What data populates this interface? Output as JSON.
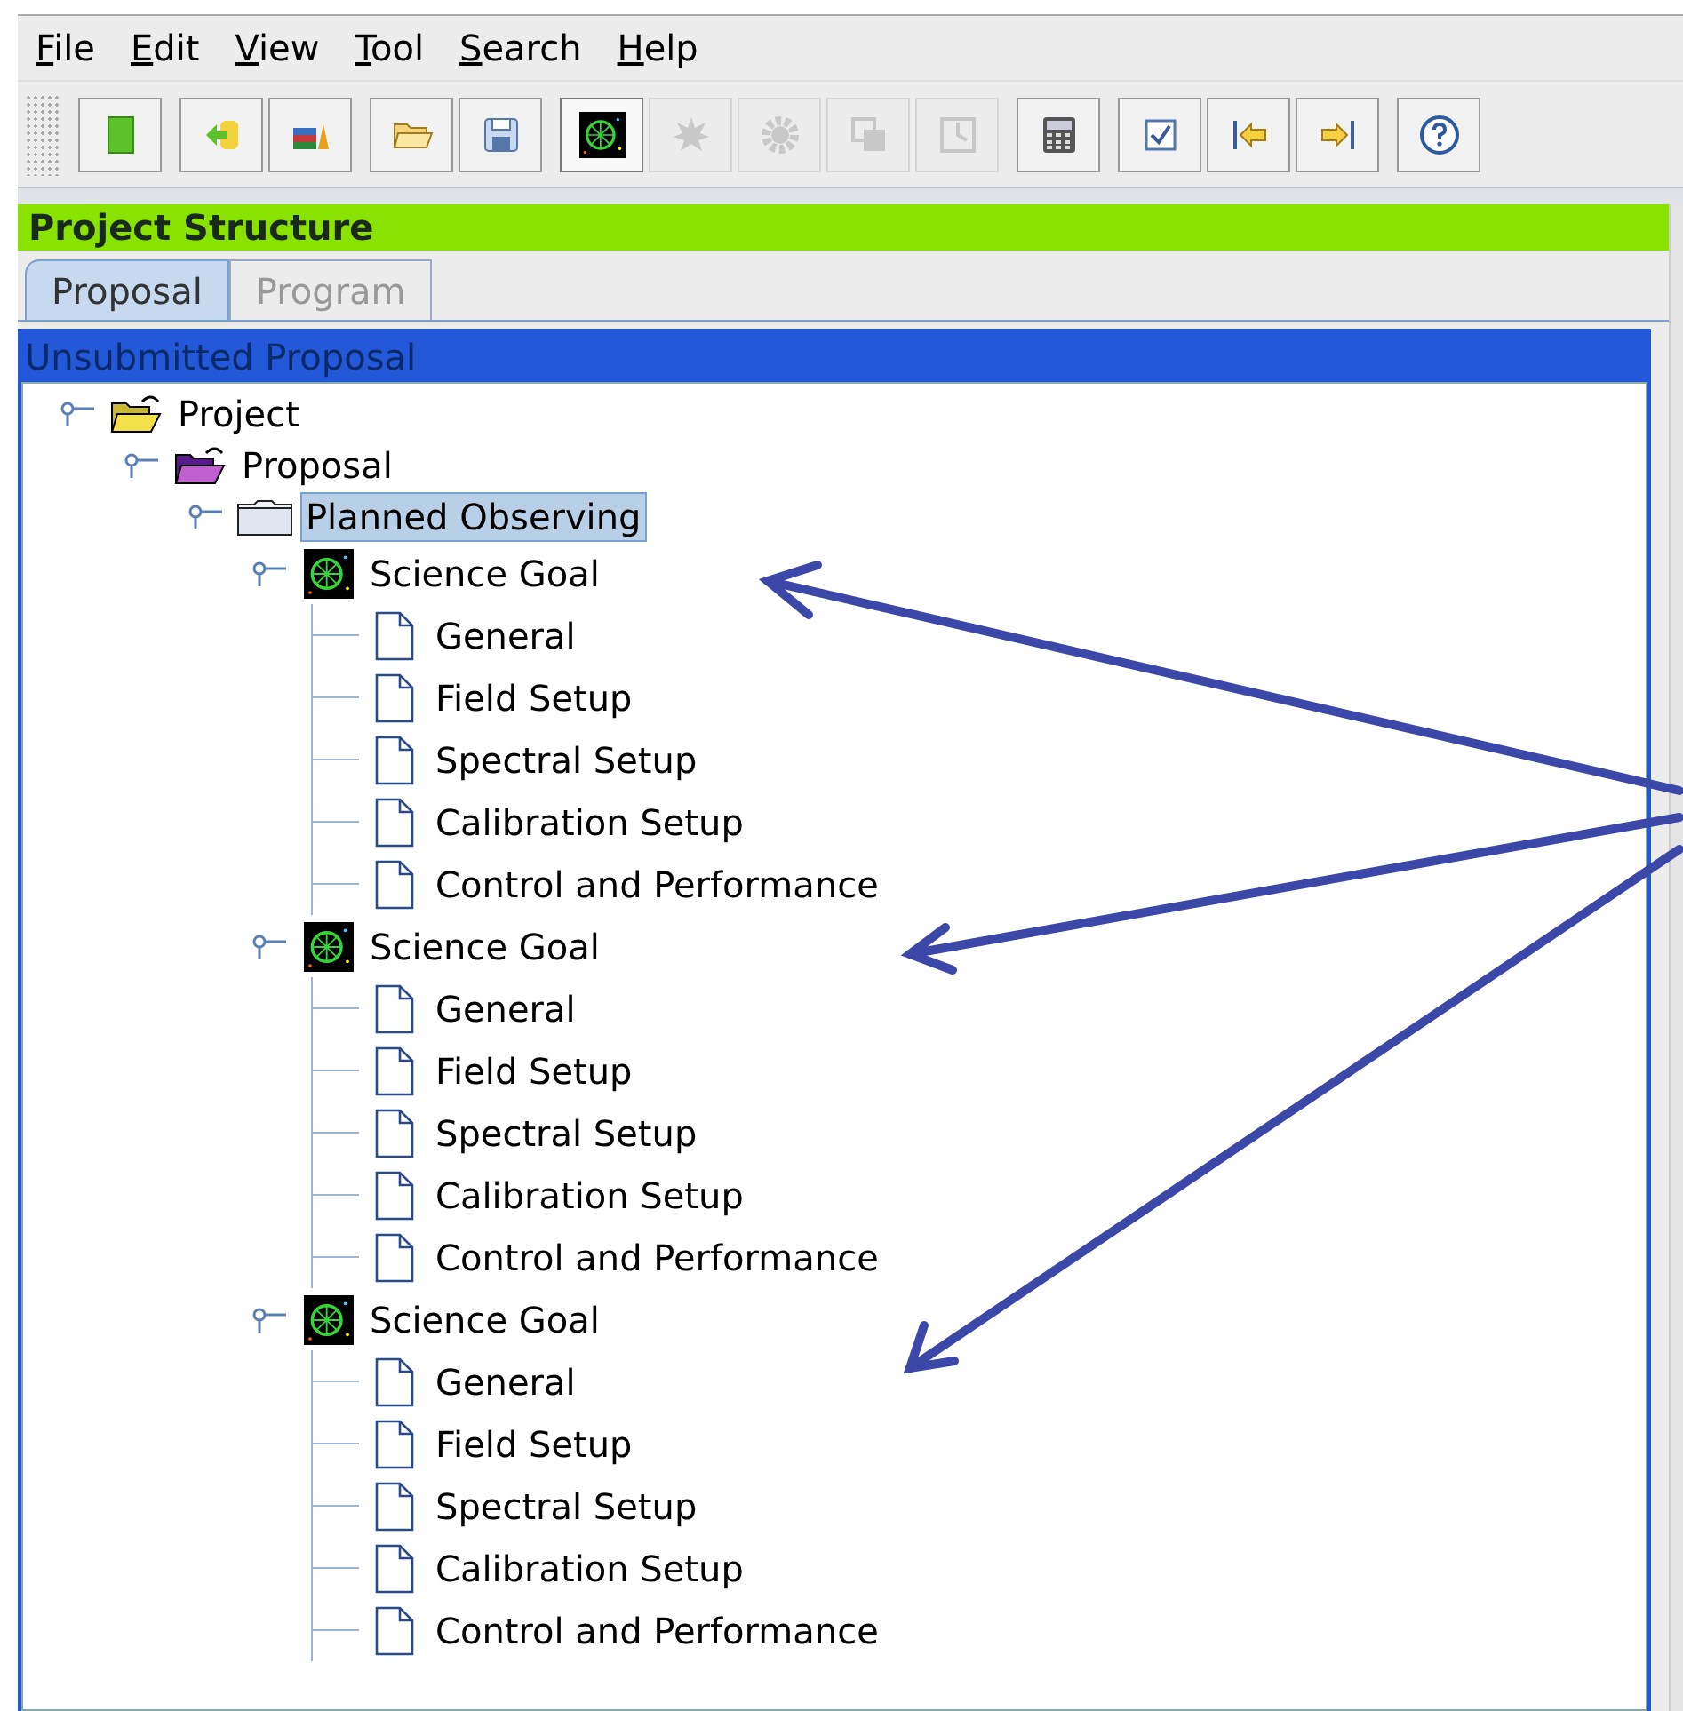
{
  "menu": [
    {
      "label": "File"
    },
    {
      "label": "Edit"
    },
    {
      "label": "View"
    },
    {
      "label": "Tool"
    },
    {
      "label": "Search"
    },
    {
      "label": "Help"
    }
  ],
  "toolbar": [
    {
      "kind": "new",
      "disabled": false,
      "pressed": false
    },
    {
      "kind": "import",
      "disabled": false,
      "pressed": false
    },
    {
      "kind": "library",
      "disabled": false,
      "pressed": false
    },
    {
      "kind": "open",
      "disabled": false,
      "pressed": false
    },
    {
      "kind": "save",
      "disabled": false,
      "pressed": false
    },
    {
      "kind": "goal",
      "disabled": false,
      "pressed": true
    },
    {
      "kind": "star",
      "disabled": true,
      "pressed": false
    },
    {
      "kind": "gear",
      "disabled": true,
      "pressed": false
    },
    {
      "kind": "copy",
      "disabled": true,
      "pressed": false
    },
    {
      "kind": "clock",
      "disabled": true,
      "pressed": false
    },
    {
      "kind": "calculator",
      "disabled": false,
      "pressed": false
    },
    {
      "kind": "check",
      "disabled": false,
      "pressed": false
    },
    {
      "kind": "first",
      "disabled": false,
      "pressed": false
    },
    {
      "kind": "last",
      "disabled": false,
      "pressed": false
    },
    {
      "kind": "help",
      "disabled": false,
      "pressed": false
    }
  ],
  "panel": {
    "title": "Project Structure"
  },
  "tabs": [
    {
      "label": "Proposal",
      "selected": true
    },
    {
      "label": "Program",
      "selected": false
    }
  ],
  "tree_title": "Unsubmitted Proposal",
  "tree": [
    {
      "label": "Project",
      "kind": "project",
      "selected": false,
      "expanded": true,
      "children": [
        {
          "label": "Proposal",
          "kind": "proposal",
          "selected": false,
          "expanded": true,
          "children": [
            {
              "label": "Planned Observing",
              "kind": "folder",
              "selected": true,
              "expanded": true,
              "children": [
                {
                  "label": "Science Goal",
                  "kind": "goal",
                  "selected": false,
                  "expanded": true,
                  "children": [
                    {
                      "label": "General",
                      "kind": "page",
                      "selected": false
                    },
                    {
                      "label": "Field Setup",
                      "kind": "page",
                      "selected": false
                    },
                    {
                      "label": "Spectral Setup",
                      "kind": "page",
                      "selected": false
                    },
                    {
                      "label": "Calibration Setup",
                      "kind": "page",
                      "selected": false
                    },
                    {
                      "label": "Control and Performance",
                      "kind": "page",
                      "selected": false
                    }
                  ]
                },
                {
                  "label": "Science Goal",
                  "kind": "goal",
                  "selected": false,
                  "expanded": true,
                  "children": [
                    {
                      "label": "General",
                      "kind": "page",
                      "selected": false
                    },
                    {
                      "label": "Field Setup",
                      "kind": "page",
                      "selected": false
                    },
                    {
                      "label": "Spectral Setup",
                      "kind": "page",
                      "selected": false
                    },
                    {
                      "label": "Calibration Setup",
                      "kind": "page",
                      "selected": false
                    },
                    {
                      "label": "Control and Performance",
                      "kind": "page",
                      "selected": false
                    }
                  ]
                },
                {
                  "label": "Science Goal",
                  "kind": "goal",
                  "selected": false,
                  "expanded": true,
                  "children": [
                    {
                      "label": "General",
                      "kind": "page",
                      "selected": false
                    },
                    {
                      "label": "Field Setup",
                      "kind": "page",
                      "selected": false
                    },
                    {
                      "label": "Spectral Setup",
                      "kind": "page",
                      "selected": false
                    },
                    {
                      "label": "Calibration Setup",
                      "kind": "page",
                      "selected": false
                    },
                    {
                      "label": "Control and Performance",
                      "kind": "page",
                      "selected": false
                    }
                  ]
                }
              ]
            }
          ]
        }
      ]
    }
  ]
}
